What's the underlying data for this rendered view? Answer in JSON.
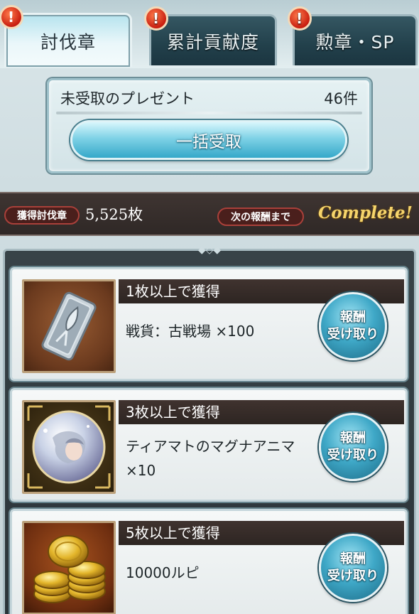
{
  "tabs": [
    {
      "label": "討伐章",
      "active": true,
      "alert": "!"
    },
    {
      "label": "累計貢献度",
      "active": false,
      "alert": "!"
    },
    {
      "label": "勲章・SP",
      "active": false,
      "alert": "!"
    }
  ],
  "present": {
    "label": "未受取のプレゼント",
    "count": "46件",
    "bulk_button": "一括受取"
  },
  "status": {
    "badge_label": "獲得討伐章",
    "badge_count": "5,525枚",
    "next_label": "次の報酬まで",
    "next_value": "Complete!"
  },
  "rewards": [
    {
      "requirement": "1枚以上で獲得",
      "item": "戦貨：古戦場 ×100",
      "button_line1": "報酬",
      "button_line2": "受け取り",
      "icon": "war-currency-card-icon"
    },
    {
      "requirement": "3枚以上で獲得",
      "item": "ティアマトのマグナアニマ ×10",
      "button_line1": "報酬",
      "button_line2": "受け取り",
      "icon": "magna-anima-orb-icon"
    },
    {
      "requirement": "5枚以上で獲得",
      "item": "10000ルピ",
      "button_line1": "報酬",
      "button_line2": "受け取り",
      "icon": "rupie-coins-icon"
    }
  ],
  "colors": {
    "accent": "#3fa8c7",
    "complete_gold": "#f5d46b",
    "alert_red": "#c81e10"
  }
}
